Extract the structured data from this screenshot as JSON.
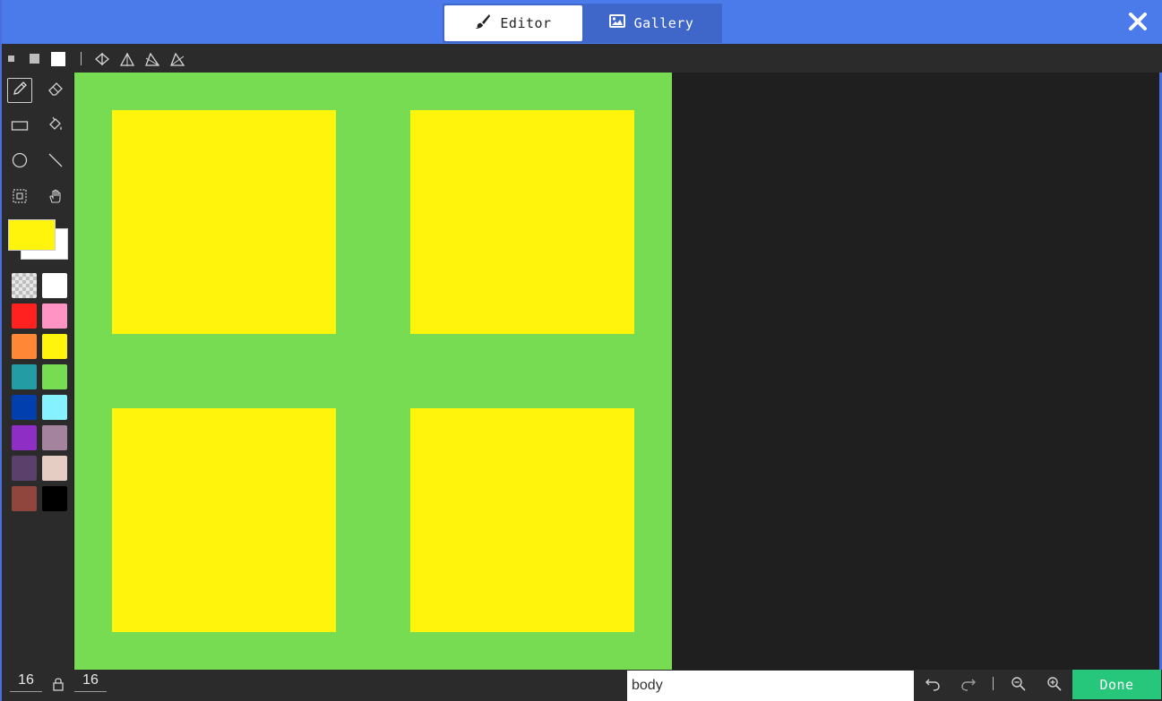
{
  "header": {
    "tabs": [
      {
        "label": "Editor",
        "icon": "brush-icon",
        "active": true
      },
      {
        "label": "Gallery",
        "icon": "image-icon",
        "active": false
      }
    ],
    "close_icon": "close-icon"
  },
  "subbar": {
    "brush_sizes": [
      "small",
      "medium",
      "large"
    ],
    "symmetry_tools": [
      "mirror-horizontal-icon",
      "mirror-vertical-icon",
      "mirror-diagonal-icon",
      "mirror-diagonal-alt-icon"
    ]
  },
  "tools": [
    {
      "name": "pencil-tool",
      "active": true
    },
    {
      "name": "eraser-tool",
      "active": false
    },
    {
      "name": "rectangle-tool",
      "active": false
    },
    {
      "name": "fill-tool",
      "active": false
    },
    {
      "name": "circle-tool",
      "active": false
    },
    {
      "name": "line-tool",
      "active": false
    },
    {
      "name": "marquee-tool",
      "active": false
    },
    {
      "name": "pan-tool",
      "active": false
    }
  ],
  "colors": {
    "primary": "#fff40b",
    "secondary": "#ffffff",
    "palette": [
      "transparent",
      "#ffffff",
      "#ff2020",
      "#ff93c4",
      "#ff8736",
      "#fff40b",
      "#249ca3",
      "#78dc52",
      "#003fad",
      "#87f2ff",
      "#8e2ec4",
      "#a4839f",
      "#5c406c",
      "#e5cdc4",
      "#91463d",
      "#000000"
    ]
  },
  "canvas": {
    "background": "#78dc52",
    "fill": "#fff40b"
  },
  "bottom": {
    "width": "16",
    "height": "16",
    "name_value": "body",
    "done_label": "Done"
  }
}
